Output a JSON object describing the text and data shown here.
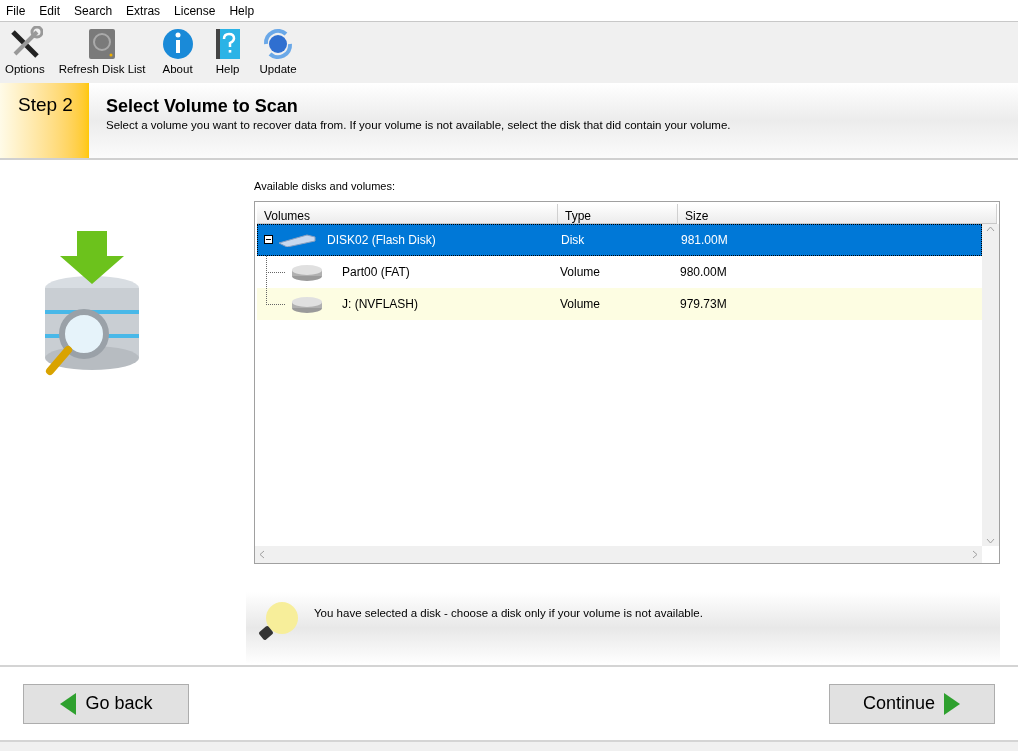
{
  "menu": [
    "File",
    "Edit",
    "Search",
    "Extras",
    "License",
    "Help"
  ],
  "toolbar": [
    {
      "kind": "options",
      "label": "Options"
    },
    {
      "kind": "refresh",
      "label": "Refresh Disk List"
    },
    {
      "kind": "about",
      "label": "About"
    },
    {
      "kind": "help",
      "label": "Help"
    },
    {
      "kind": "update",
      "label": "Update"
    }
  ],
  "step": {
    "badge": "Step 2",
    "title": "Select Volume to Scan",
    "description": "Select a volume you want to recover data from. If your volume is not available, select the disk that did contain your volume."
  },
  "list_label": "Available disks and volumes:",
  "table": {
    "columns": [
      "Volumes",
      "Type",
      "Size"
    ],
    "rows": [
      {
        "kind": "disk",
        "name": "DISK02 (Flash Disk)",
        "type": "Disk",
        "size": "981.00M",
        "selected": true,
        "expanded": true,
        "children": [
          {
            "kind": "volume",
            "name": "Part00 (FAT)",
            "type": "Volume",
            "size": "980.00M",
            "selected": false,
            "highlighted": false
          },
          {
            "kind": "volume",
            "name": "J: (NVFLASH)",
            "type": "Volume",
            "size": "979.73M",
            "selected": false,
            "highlighted": true
          }
        ]
      }
    ]
  },
  "hint": "You have selected a disk - choose a disk only if your volume is not available.",
  "buttons": [
    {
      "kind": "back",
      "label": "Go back"
    },
    {
      "kind": "continue",
      "label": "Continue"
    }
  ]
}
